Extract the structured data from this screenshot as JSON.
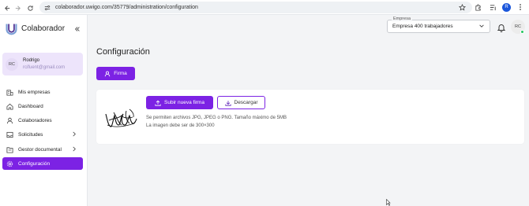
{
  "browser": {
    "url": "colaborador.uwigo.com/35779/administration/configuration",
    "profile_initial": "R"
  },
  "sidebar": {
    "brand": "Colaborador",
    "user": {
      "initials": "RC",
      "name": "Rodrigo",
      "email": "rcifuent@gmail.com"
    },
    "items": [
      {
        "label": "Mis empresas",
        "icon": "building-icon",
        "has_chevron": false
      },
      {
        "label": "Dashboard",
        "icon": "home-icon",
        "has_chevron": false
      },
      {
        "label": "Colaboradores",
        "icon": "user-icon",
        "has_chevron": false
      },
      {
        "label": "Solicitudes",
        "icon": "inbox-icon",
        "has_chevron": true
      },
      {
        "label": "Gestor documental",
        "icon": "folder-icon",
        "has_chevron": true
      },
      {
        "label": "Configuración",
        "icon": "gear-icon",
        "has_chevron": false,
        "active": true
      }
    ]
  },
  "header": {
    "company_label": "Empresa",
    "company_value": "Empresa 400 trabajadores",
    "avatar_initials": "RC"
  },
  "main": {
    "title": "Configuración",
    "tab_label": "Firma",
    "upload_label": "Subir nueva firma",
    "download_label": "Descargar",
    "hint_formats": "Se permiten archivos JPG, JPEG o PNG. Tamaño máximo de 5MB",
    "hint_size": "La imagen debe ser de 300×300"
  },
  "colors": {
    "accent": "#7c22e4",
    "user_card_bg": "#ede4fb",
    "online": "#22c55e"
  }
}
